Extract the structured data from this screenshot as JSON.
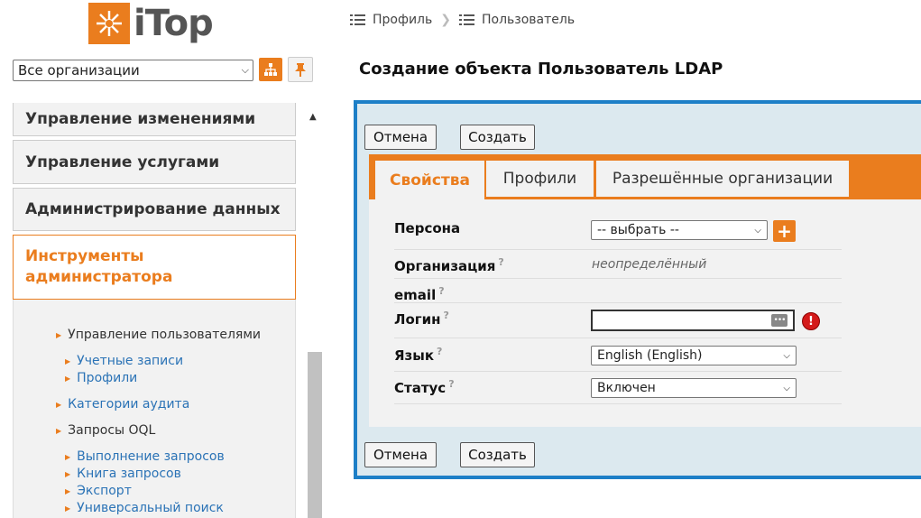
{
  "app": {
    "logo_text": "iTop"
  },
  "sidebar": {
    "org_select": {
      "value": "Все организации"
    },
    "menu_groups": [
      {
        "label": "Управление изменениями"
      },
      {
        "label": "Управление услугами"
      },
      {
        "label": "Администрирование данных"
      },
      {
        "label": "Инструменты администратора"
      }
    ],
    "tree": {
      "user_mgmt": "Управление пользователями",
      "accounts": "Учетные записи",
      "profiles": "Профили",
      "audit": "Категории аудита",
      "oql": "Запросы OQL",
      "run_queries": "Выполнение запросов",
      "query_book": "Книга запросов",
      "export": "Экспорт",
      "universal_search": "Универсальный поиск"
    }
  },
  "breadcrumb": [
    {
      "label": "Профиль"
    },
    {
      "label": "Пользователь"
    }
  ],
  "page": {
    "title": "Создание объекта Пользователь LDAP"
  },
  "buttons": {
    "cancel": "Отмена",
    "create": "Создать"
  },
  "tabs": [
    {
      "label": "Свойства",
      "active": true
    },
    {
      "label": "Профили",
      "active": false
    },
    {
      "label": "Разрешённые организации",
      "active": false
    }
  ],
  "fields": {
    "person": {
      "label": "Персона",
      "value": "-- выбрать --"
    },
    "org": {
      "label": "Организация",
      "value": "неопределённый"
    },
    "email": {
      "label": "email"
    },
    "login": {
      "label": "Логин",
      "value": ""
    },
    "language": {
      "label": "Язык",
      "value": "English (English)"
    },
    "status": {
      "label": "Статус",
      "value": "Включен"
    },
    "help_mark": "?"
  },
  "colors": {
    "accent": "#ea7d1e",
    "frame": "#1d7fc7",
    "link": "#2b73b6",
    "error": "#d41a1a"
  }
}
